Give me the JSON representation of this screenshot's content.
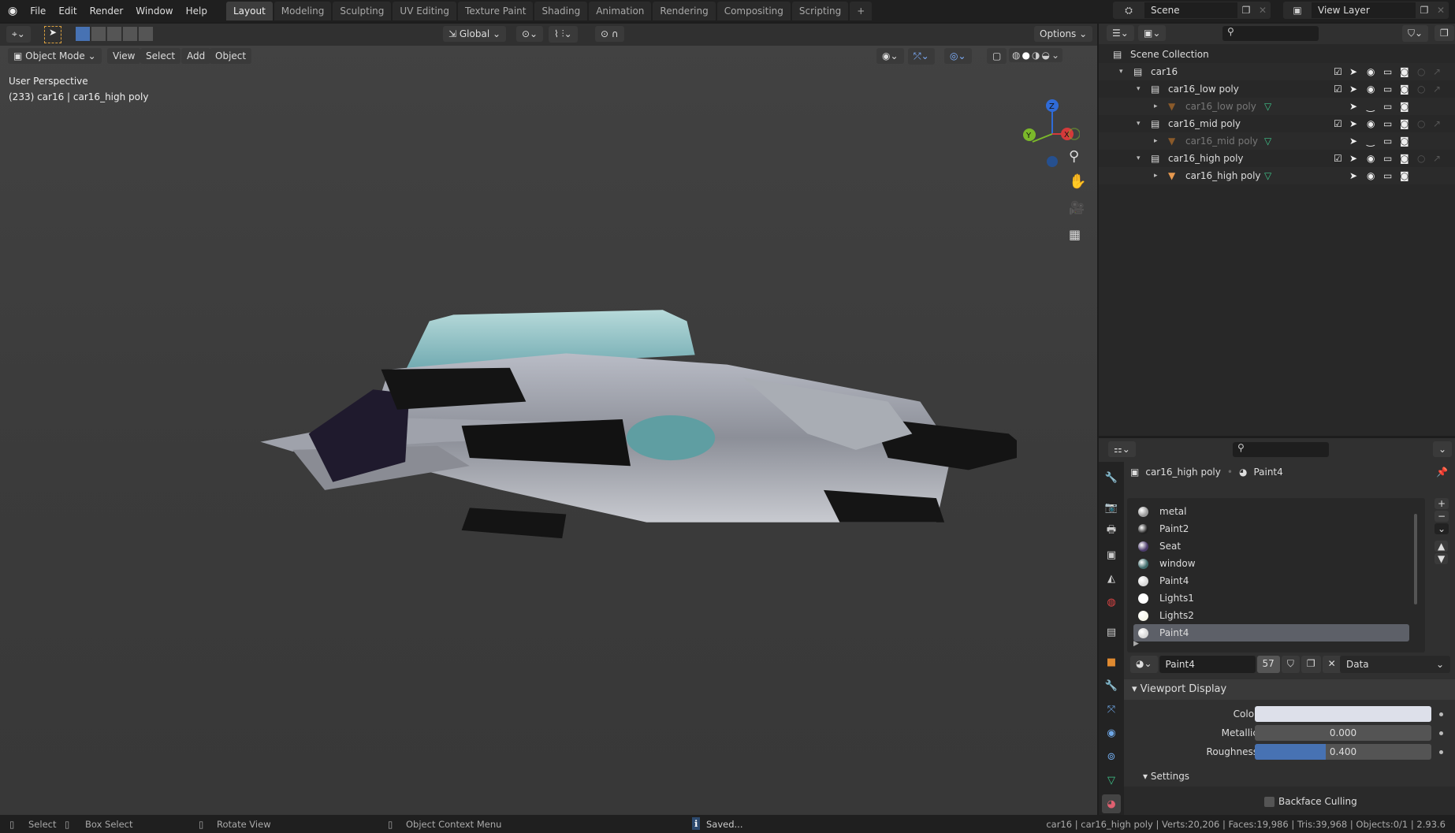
{
  "topbar": {
    "menus": [
      "File",
      "Edit",
      "Render",
      "Window",
      "Help"
    ],
    "workspaces": [
      "Layout",
      "Modeling",
      "Sculpting",
      "UV Editing",
      "Texture Paint",
      "Shading",
      "Animation",
      "Rendering",
      "Compositing",
      "Scripting"
    ],
    "add": "+",
    "scene": "Scene",
    "view_layer": "View Layer"
  },
  "toolheader": {
    "orientation": "Global",
    "options": "Options"
  },
  "viewport": {
    "mode": "Object Mode",
    "menus": [
      "View",
      "Select",
      "Add",
      "Object"
    ],
    "perspective": "User Perspective",
    "object_info": "(233) car16 | car16_high poly",
    "gizmo": {
      "x": "X",
      "y": "Y",
      "z": "Z"
    }
  },
  "outliner": {
    "rows": [
      {
        "label": "Scene Collection",
        "type": "scene-collection"
      },
      {
        "label": "car16",
        "type": "collection"
      },
      {
        "label": "car16_low poly",
        "type": "collection"
      },
      {
        "label": "car16_low poly",
        "type": "object",
        "dim": true
      },
      {
        "label": "car16_mid poly",
        "type": "collection"
      },
      {
        "label": "car16_mid poly",
        "type": "object",
        "dim": true
      },
      {
        "label": "car16_high poly",
        "type": "collection"
      },
      {
        "label": "car16_high poly",
        "type": "object",
        "dim": false
      }
    ]
  },
  "properties": {
    "object": "car16_high poly",
    "material": "Paint4",
    "slots": [
      {
        "name": "metal",
        "color": "#9a9a9a"
      },
      {
        "name": "Paint2",
        "color": "#222"
      },
      {
        "name": "Seat",
        "color": "#4a3a6a"
      },
      {
        "name": "window",
        "color": "#3f6a6a"
      },
      {
        "name": "Paint4",
        "color": "#d8d8d8"
      },
      {
        "name": "Lights1",
        "color": "#fff"
      },
      {
        "name": "Lights2",
        "color": "#f6f6ea"
      },
      {
        "name": "Paint4",
        "color": "#d8d8d8",
        "selected": true
      }
    ],
    "material_field": "Paint4",
    "users": "57",
    "link": "Data",
    "viewport_display": {
      "title": "Viewport Display",
      "color_label": "Color",
      "color": "#dde0ea",
      "metallic_label": "Metallic",
      "metallic": "0.000",
      "roughness_label": "Roughness",
      "roughness": "0.400",
      "roughness_fraction": 0.4,
      "settings": "Settings",
      "backface": "Backface Culling"
    }
  },
  "status": {
    "select": "Select",
    "box_select": "Box Select",
    "rotate": "Rotate View",
    "context": "Object Context Menu",
    "saved": "Saved...",
    "stats": "car16 | car16_high poly | Verts:20,206 | Faces:19,986 | Tris:39,968 | Objects:0/1 | 2.93.6"
  }
}
